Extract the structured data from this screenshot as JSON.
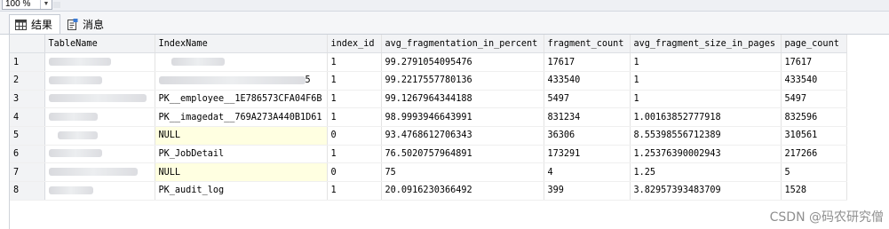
{
  "zoom": {
    "value": "100 %"
  },
  "tabs": [
    {
      "label": "结果",
      "icon": "grid-icon"
    },
    {
      "label": "消息",
      "icon": "messages-icon"
    }
  ],
  "grid": {
    "columns": [
      "TableName",
      "IndexName",
      "index_id",
      "avg_fragmentation_in_percent",
      "fragment_count",
      "avg_fragment_size_in_pages",
      "page_count"
    ],
    "rows": [
      {
        "num": "1",
        "index_name": "",
        "index_id": "1",
        "avg_frag": "99.2791054095476",
        "fragment_count": "17617",
        "avg_size": "1",
        "page_count": "17617"
      },
      {
        "num": "2",
        "index_name": "5",
        "index_id": "1",
        "avg_frag": "99.2217557780136",
        "fragment_count": "433540",
        "avg_size": "1",
        "page_count": "433540"
      },
      {
        "num": "3",
        "index_name": "PK__employee__1E786573CFA04F6B",
        "index_id": "1",
        "avg_frag": "99.1267964344188",
        "fragment_count": "5497",
        "avg_size": "1",
        "page_count": "5497"
      },
      {
        "num": "4",
        "index_name": "PK__imagedat__769A273A440B1D61",
        "index_id": "1",
        "avg_frag": "98.9993946643991",
        "fragment_count": "831234",
        "avg_size": "1.00163852777918",
        "page_count": "832596"
      },
      {
        "num": "5",
        "index_name": "NULL",
        "index_id": "0",
        "avg_frag": "93.4768612706343",
        "fragment_count": "36306",
        "avg_size": "8.55398556712389",
        "page_count": "310561"
      },
      {
        "num": "6",
        "index_name": "PK_JobDetail",
        "index_id": "1",
        "avg_frag": "76.5020757964891",
        "fragment_count": "173291",
        "avg_size": "1.25376390002943",
        "page_count": "217266"
      },
      {
        "num": "7",
        "index_name": "NULL",
        "index_id": "0",
        "avg_frag": "75",
        "fragment_count": "4",
        "avg_size": "1.25",
        "page_count": "5"
      },
      {
        "num": "8",
        "index_name": "PK_audit_log",
        "index_id": "1",
        "avg_frag": "20.0916230366492",
        "fragment_count": "399",
        "avg_size": "3.82957393483709",
        "page_count": "1528"
      }
    ]
  },
  "watermark": "CSDN @码农研究僧"
}
